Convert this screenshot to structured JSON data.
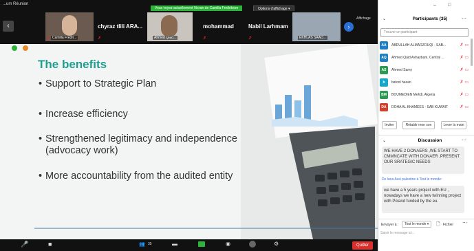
{
  "window": {
    "title": "...um Réunion"
  },
  "share_bar": {
    "notice": "Vous voyez actuellement l'écran de Camilla Fredriksen",
    "options": "Options d'affichage ▾"
  },
  "filmstrip": {
    "tile1_name": "Camilla Fredri...",
    "name2": "chyraz tlili ARA...",
    "tile3_name": "Ahmed Qaid...",
    "name4": "mohammad",
    "name5": "Nabil Larhmam",
    "tile6_name": "EKHLAS SAAD...",
    "display_label": "Affichage"
  },
  "slide": {
    "title": "The benefits",
    "bullets": [
      "Support to Strategic Plan",
      "Increase efficiency",
      "Strengthened legitimacy and independence (advocacy work)",
      "More accountability from the audited entity"
    ]
  },
  "bottom": {
    "participant_count": "35",
    "quit": "Quitter"
  },
  "participants": {
    "header": "Participants (35)",
    "search_placeholder": "Trouver un participant",
    "items": [
      {
        "initials": "AA",
        "name": "ABDULLAH ALMARZOUQI - SAB...",
        "color": "#1f7fc1"
      },
      {
        "initials": "AQ",
        "name": "Ahmed Qaid Ashaybani, Central ...",
        "color": "#1f7fc1"
      },
      {
        "initials": "AS",
        "name": "Ahmed Samy",
        "color": "#2c9a52"
      },
      {
        "initials": "b",
        "name": "batool hasan",
        "color": "#19a7c9"
      },
      {
        "initials": "BM",
        "name": "BOUMEDIEN Mehdi, Algeria",
        "color": "#2c9a52"
      },
      {
        "initials": "DA",
        "name": "DOHA AL KHAMEES - SAB KUWAIT",
        "color": "#d0402a"
      }
    ],
    "invite": "Inviter",
    "restore": "Rétablir mon son",
    "lower": "Lever la main"
  },
  "chat": {
    "header": "Discussion",
    "msg1": "WE HAVE 2 DONAERS ,WE START TO CMMNCATE WITH DONAER ,PRESENT OUR SRATEGIC NEEDS",
    "meta2": "De lana Assi palestine à Tout le monde:",
    "msg2": "we have a 5 years project with EU , nowadays we have a new twinning project with Poland funded by the eu.",
    "send_to_label": "Envoyer à :",
    "send_to_value": "Tout le monde ▾",
    "file_label": "Fichier",
    "input_placeholder": "Saisir le message ici..."
  }
}
